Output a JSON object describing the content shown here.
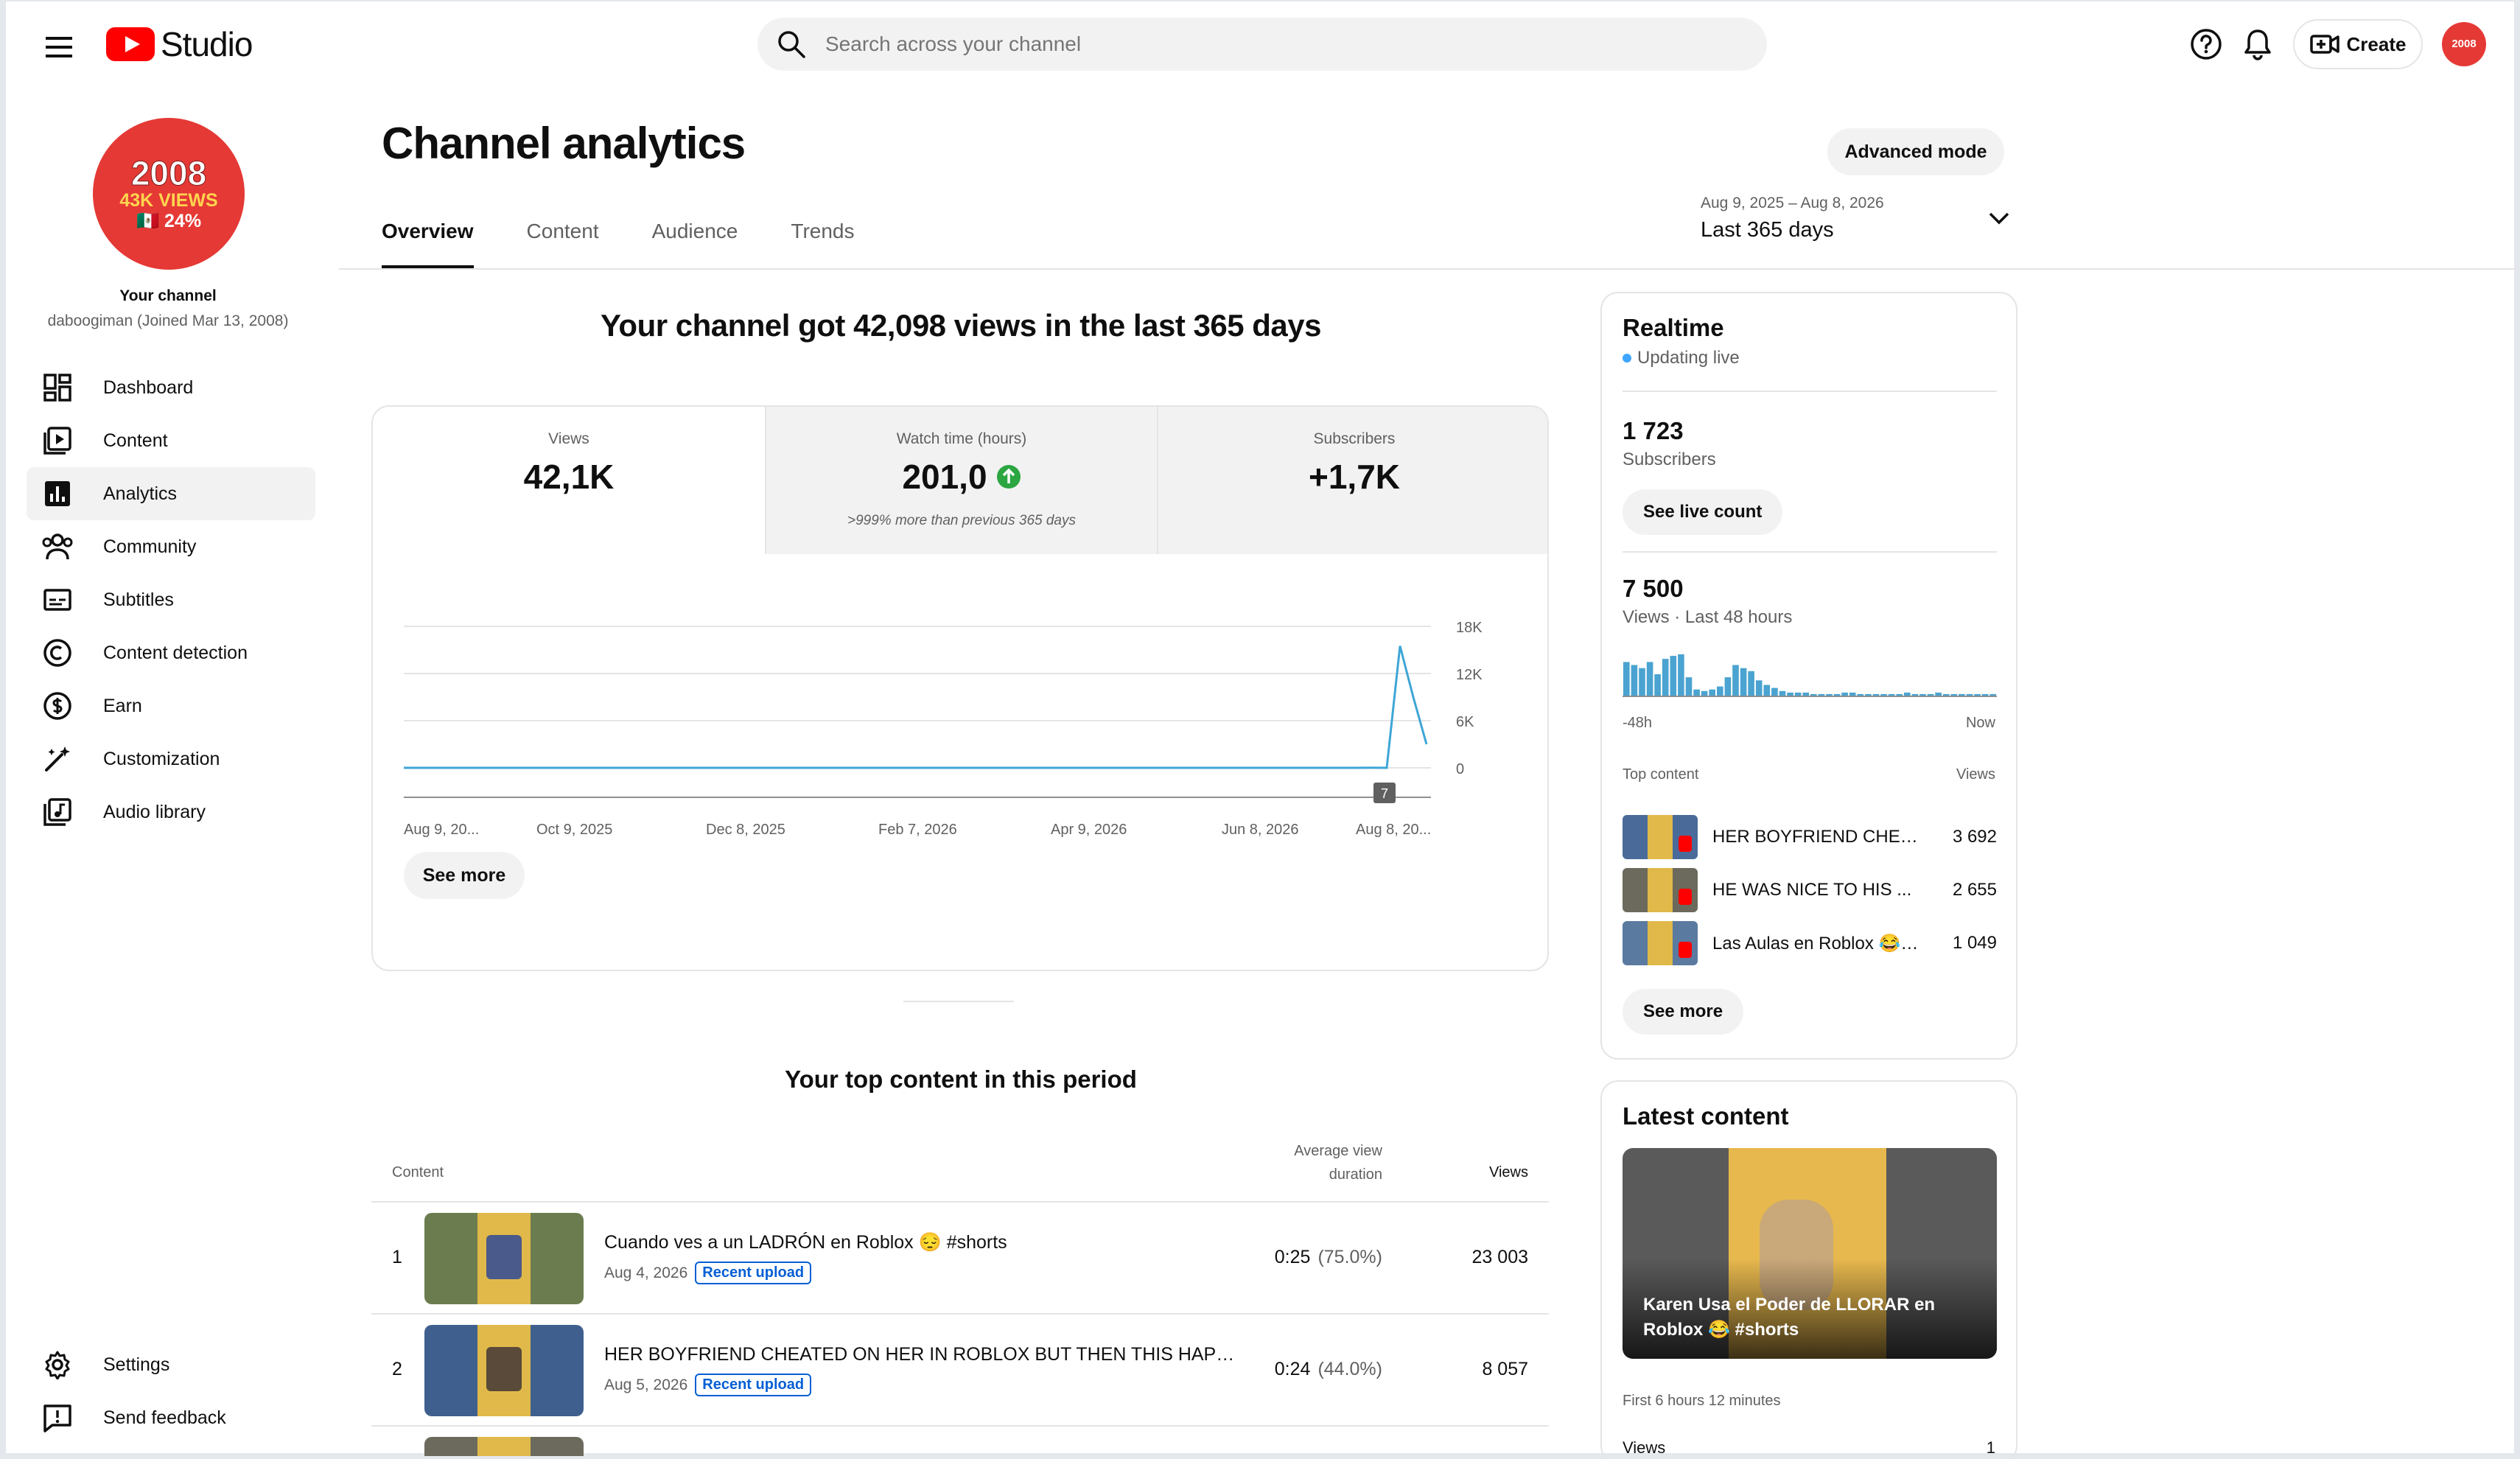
{
  "header": {
    "logo_text": "Studio",
    "search_placeholder": "Search across your channel",
    "create_label": "Create",
    "avatar_text": "2008"
  },
  "sidebar": {
    "avatar": {
      "year": "2008",
      "views": "43K VIEWS",
      "pct": "🇲🇽 24%"
    },
    "your_channel": "Your channel",
    "channel_sub": "daboogiman (Joined Mar 13, 2008)",
    "items": [
      {
        "label": "Dashboard",
        "icon": "dashboard-icon"
      },
      {
        "label": "Content",
        "icon": "content-icon"
      },
      {
        "label": "Analytics",
        "icon": "analytics-icon",
        "active": true
      },
      {
        "label": "Community",
        "icon": "community-icon"
      },
      {
        "label": "Subtitles",
        "icon": "subtitles-icon"
      },
      {
        "label": "Content detection",
        "icon": "copyright-icon"
      },
      {
        "label": "Earn",
        "icon": "dollar-icon"
      },
      {
        "label": "Customization",
        "icon": "magic-wand-icon"
      },
      {
        "label": "Audio library",
        "icon": "audio-library-icon"
      }
    ],
    "bottom_items": [
      {
        "label": "Settings",
        "icon": "gear-icon"
      },
      {
        "label": "Send feedback",
        "icon": "feedback-icon"
      }
    ]
  },
  "main": {
    "title": "Channel analytics",
    "advanced_mode": "Advanced mode",
    "tabs": [
      "Overview",
      "Content",
      "Audience",
      "Trends"
    ],
    "date_range": {
      "dates": "Aug 9, 2025 – Aug 8, 2026",
      "label": "Last 365 days"
    },
    "headline": "Your channel got 42,098 views in the last 365 days",
    "metrics": [
      {
        "label": "Views",
        "value": "42,1K",
        "note": ""
      },
      {
        "label": "Watch time (hours)",
        "value": "201,0",
        "note": ">999% more than previous 365 days"
      },
      {
        "label": "Subscribers",
        "value": "+1,7K",
        "note": ""
      }
    ],
    "see_more": "See more",
    "top_content_title": "Your top content in this period",
    "table": {
      "col_content": "Content",
      "col_avd": "Average view duration",
      "col_views": "Views",
      "rows": [
        {
          "rank": "1",
          "title": "Cuando ves a un LADRÓN en Roblox 😔 #shorts",
          "date": "Aug 4, 2026",
          "badge": "Recent upload",
          "duration": "0:25",
          "pct": "(75.0%)",
          "views": "23 003"
        },
        {
          "rank": "2",
          "title": "HER BOYFRIEND CHEATED ON HER IN ROBLOX BUT THEN THIS HAPPENED...",
          "date": "Aug 5, 2026",
          "badge": "Recent upload",
          "duration": "0:24",
          "pct": "(44.0%)",
          "views": "8 057"
        }
      ]
    }
  },
  "chart_data": [
    {
      "type": "line",
      "series": [
        {
          "values": [
            0,
            0,
            0,
            0,
            0,
            0,
            0,
            0,
            0,
            0,
            0,
            0,
            0,
            0,
            0,
            0,
            0,
            0,
            0,
            0,
            0,
            0,
            0,
            0,
            0,
            0,
            0,
            0,
            0,
            0,
            0,
            0,
            0,
            0,
            0,
            0,
            0,
            0,
            0,
            0,
            0,
            0,
            0,
            0,
            0,
            0,
            0,
            0,
            0,
            0,
            0,
            0,
            0,
            0,
            0,
            0,
            0,
            0,
            0,
            0,
            7,
            0,
            15500,
            9000,
            3000
          ]
        }
      ],
      "x_tick_labels": [
        "Aug 9, 20...",
        "Oct 9, 2025",
        "Dec 8, 2025",
        "Feb 7, 2026",
        "Apr 9, 2026",
        "Jun 8, 2026",
        "Aug 8, 20..."
      ],
      "y_tick_labels": [
        "18K",
        "12K",
        "6K",
        "0"
      ],
      "ylim": [
        0,
        18000
      ],
      "marker_label": "7",
      "color": "#3ea6d6",
      "grid": true
    },
    {
      "type": "bar",
      "values": [
        22,
        20,
        18,
        22,
        14,
        24,
        26,
        27,
        12,
        4,
        3,
        4,
        6,
        12,
        20,
        18,
        16,
        10,
        7,
        5,
        3,
        2,
        2,
        2,
        1,
        1,
        1,
        1,
        2,
        2,
        1,
        1,
        1,
        1,
        1,
        1,
        2,
        1,
        1,
        1,
        2,
        1,
        1,
        1,
        1,
        1,
        1,
        1
      ],
      "x_tick_labels": [
        "-48h",
        "Now"
      ],
      "color": "#4aa3d0"
    }
  ],
  "realtime": {
    "title": "Realtime",
    "status": "Updating live",
    "subscribers": "1 723",
    "subscribers_label": "Subscribers",
    "see_live_count": "See live count",
    "views": "7 500",
    "views_label": "Views · Last 48 hours",
    "axis_left": "-48h",
    "axis_right": "Now",
    "top_content_label": "Top content",
    "views_col": "Views",
    "top_content": [
      {
        "title": "HER BOYFRIEND CHEATED ON HER...",
        "views": "3 692"
      },
      {
        "title": "HE WAS NICE TO HIS ...",
        "views": "2 655"
      },
      {
        "title": "Las Aulas en Roblox 😂 #shorts",
        "views": "1 049"
      }
    ],
    "see_more": "See more"
  },
  "latest": {
    "title": "Latest content",
    "video_title": "Karen Usa el Poder de LLORAR en Roblox 😂 #shorts",
    "first_period": "First 6 hours 12 minutes",
    "views_label": "Views",
    "views_value": "1"
  },
  "colors": {
    "accent": "#065fd4",
    "brand_red": "#ff0000",
    "chart_blue": "#3ea6d6",
    "up_green": "#2ba640"
  }
}
